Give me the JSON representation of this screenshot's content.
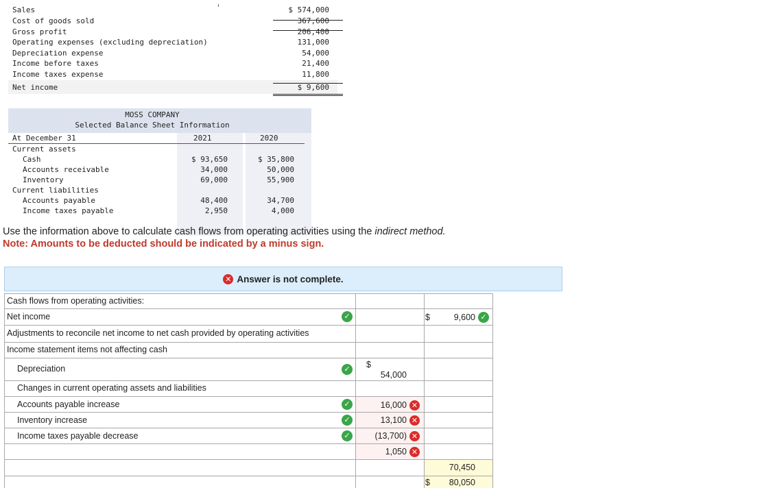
{
  "income_statement": {
    "rows": [
      {
        "label": "Sales",
        "amount": "$ 574,000"
      },
      {
        "label": "Cost of goods sold",
        "amount": "367,600"
      },
      {
        "label": "Gross profit",
        "amount": "206,400"
      },
      {
        "label": "Operating expenses (excluding depreciation)",
        "amount": "131,000"
      },
      {
        "label": "Depreciation expense",
        "amount": "54,000"
      },
      {
        "label": "Income before taxes",
        "amount": "21,400"
      },
      {
        "label": "Income taxes expense",
        "amount": "11,800"
      },
      {
        "label": "Net income",
        "amount": "$ 9,600"
      }
    ]
  },
  "balance_sheet": {
    "company": "MOSS COMPANY",
    "subtitle": "Selected Balance Sheet Information",
    "date_label": "At December 31",
    "year1": "2021",
    "year2": "2020",
    "current_assets_label": "Current assets",
    "cash": {
      "label": "Cash",
      "y1": "$ 93,650",
      "y2": "$ 35,800"
    },
    "ar": {
      "label": "Accounts receivable",
      "y1": "34,000",
      "y2": "50,000"
    },
    "inventory": {
      "label": "Inventory",
      "y1": "69,000",
      "y2": "55,900"
    },
    "current_liabilities_label": "Current liabilities",
    "ap": {
      "label": "Accounts payable",
      "y1": "48,400",
      "y2": "34,700"
    },
    "itp": {
      "label": "Income taxes payable",
      "y1": "2,950",
      "y2": "4,000"
    }
  },
  "instructions": {
    "text_before": "Use the information above to calculate cash flows from operating activities using the ",
    "text_italic": "indirect method.",
    "note": "Note: Amounts to be deducted should be indicated by a minus sign."
  },
  "banner": {
    "text": "Answer is not complete."
  },
  "cash_flow": {
    "header": "Cash flows from operating activities:",
    "net_income_label": "Net income",
    "net_income_dollar": "$",
    "net_income_value": "9,600",
    "adjustments_label": "Adjustments to reconcile net income to net cash provided by operating activities",
    "noncash_label": "Income statement items not affecting cash",
    "depreciation_label": "Depreciation",
    "depreciation_dollar": "$",
    "depreciation_value": "54,000",
    "changes_label": "Changes in current operating assets and liabilities",
    "ap_label": "Accounts payable increase",
    "ap_value": "16,000",
    "inv_label": "Inventory increase",
    "inv_value": "13,100",
    "itp_label": "Income taxes payable decrease",
    "itp_value": "(13,700)",
    "extra_value": "1,050",
    "total_adjust_value": "70,450",
    "total_dollar": "$",
    "total_value": "80,050"
  }
}
